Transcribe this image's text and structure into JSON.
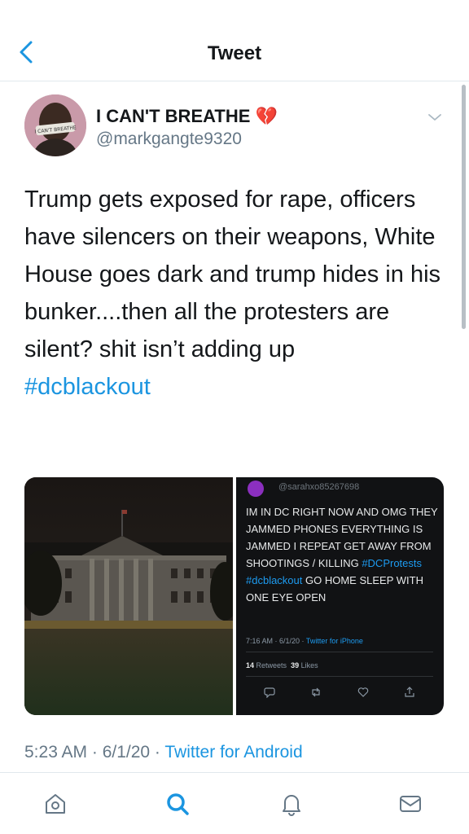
{
  "header": {
    "title": "Tweet",
    "back_icon": "chevron-left-icon"
  },
  "tweet": {
    "display_name": "I CAN'T BREATHE 💔",
    "handle": "@markgangte9320",
    "avatar_caption": "I CAN'T BREATHE",
    "text": "Trump gets exposed for rape, officers have silencers on their weapons, White House goes dark and trump hides in his bunker....then all the protesters are silent? shit isn’t adding up",
    "hashtag": "#dcblackout",
    "timestamp": "5:23 AM · 6/1/20 · ",
    "source": "Twitter for Android"
  },
  "embedded_screenshot": {
    "handle": "@sarahxo85267698",
    "text_plain": "IM IN DC RIGHT NOW AND OMG THEY JAMMED PHONES EVERYTHING IS JAMMED I REPEAT GET AWAY FROM SHOOTINGS / KILLING ",
    "hashtag_1": "#DCProtests",
    "hashtag_2": "#dcblackout",
    "text_tail": " GO HOME SLEEP WITH ONE EYE OPEN",
    "meta_time": "7:16 AM · 6/1/20 · ",
    "meta_source": "Twitter for iPhone",
    "retweets_count": "14",
    "retweets_label": "Retweets",
    "likes_count": "39",
    "likes_label": "Likes"
  },
  "tabbar": {
    "items": [
      "home-icon",
      "search-icon",
      "notifications-icon",
      "messages-icon"
    ],
    "active": "search-icon"
  },
  "colors": {
    "accent": "#1b95e0",
    "text": "#14171a",
    "muted": "#657786"
  }
}
